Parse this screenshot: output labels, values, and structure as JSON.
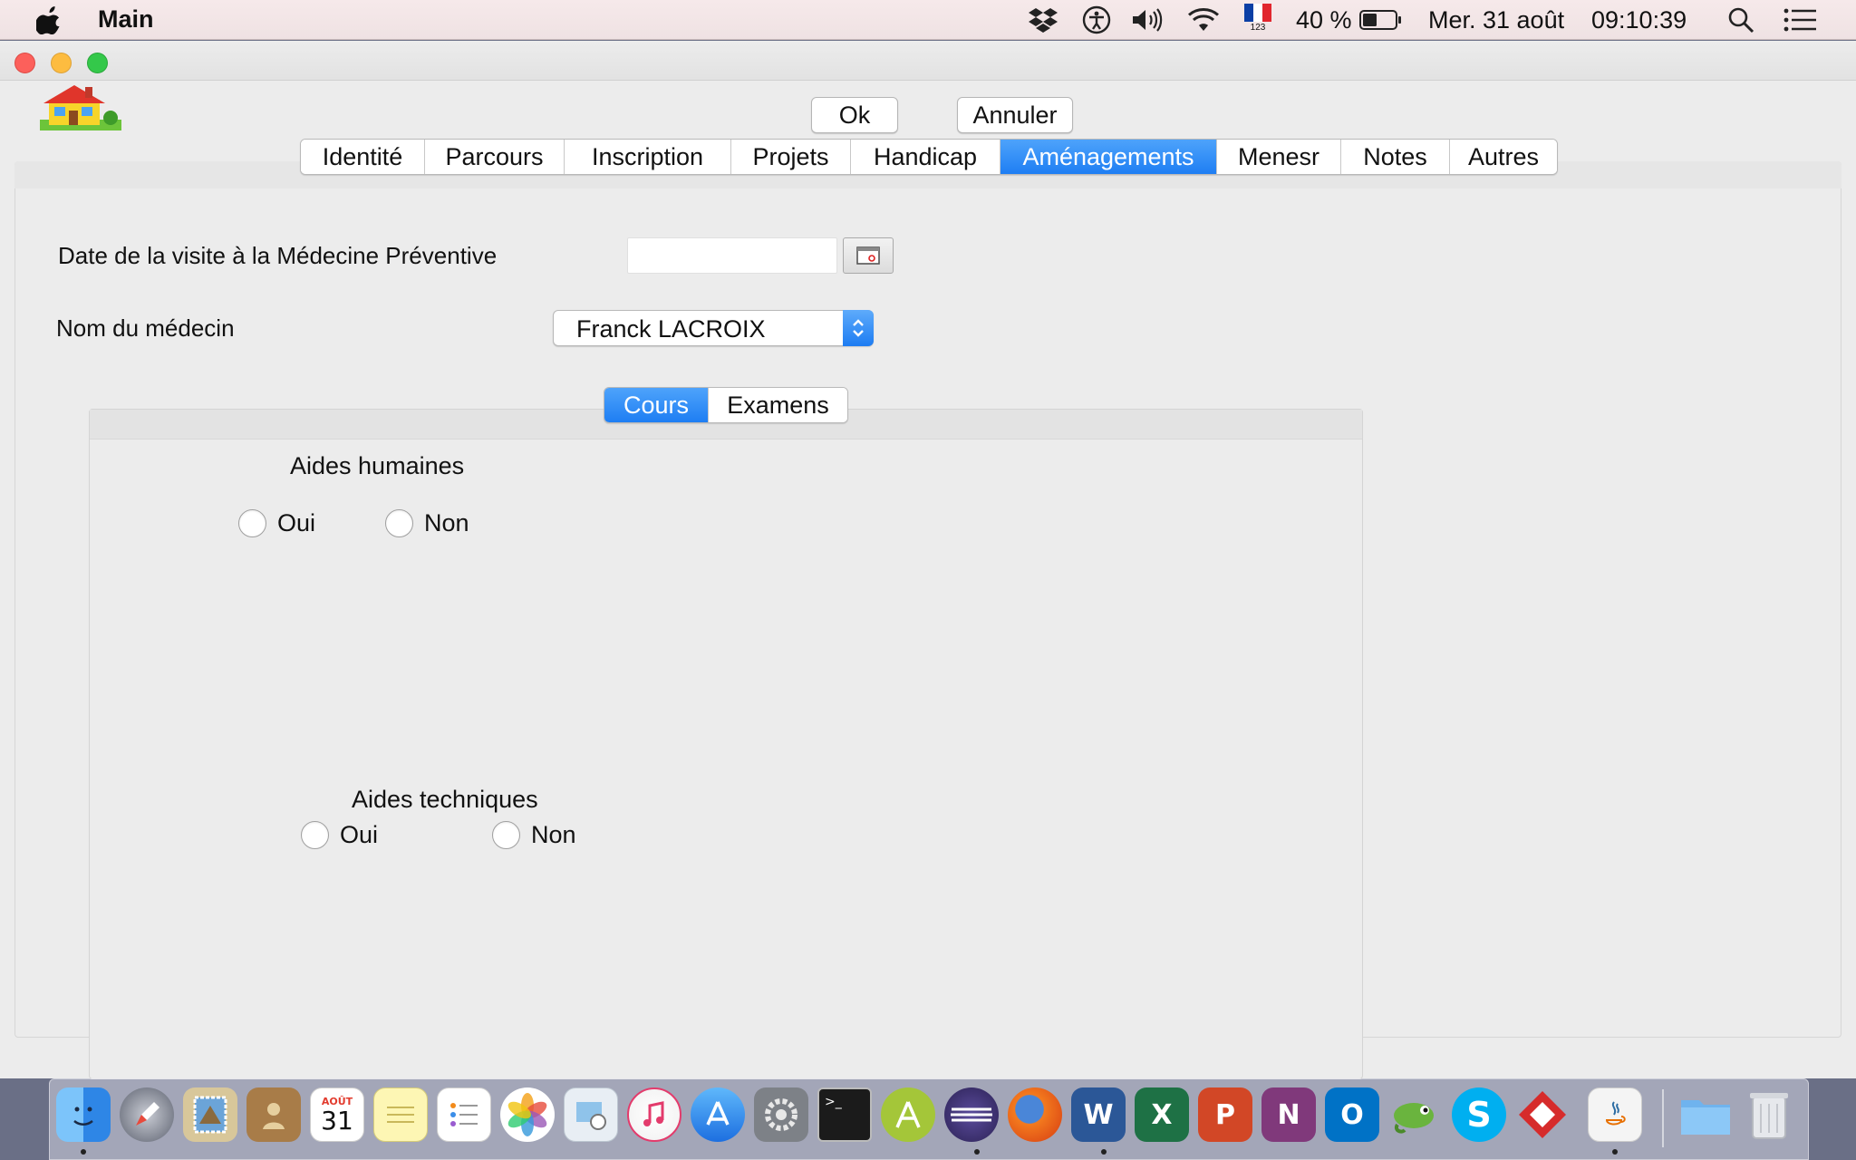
{
  "menubar": {
    "app_name": "Main",
    "battery": "40 %",
    "date": "Mer. 31 août",
    "time": "09:10:39",
    "keyboard_layout": "123",
    "icons": [
      "apple-icon",
      "dropbox-icon",
      "accessibility-icon",
      "volume-icon",
      "wifi-icon",
      "flag-fr-icon",
      "battery-icon",
      "spotlight-icon",
      "notification-center-icon"
    ]
  },
  "window": {
    "buttons": {
      "ok": "Ok",
      "cancel": "Annuler"
    },
    "tabs": [
      {
        "label": "Identité",
        "active": false
      },
      {
        "label": "Parcours",
        "active": false
      },
      {
        "label": "Inscription",
        "active": false
      },
      {
        "label": "Projets",
        "active": false
      },
      {
        "label": "Handicap",
        "active": false
      },
      {
        "label": "Aménagements",
        "active": true
      },
      {
        "label": "Menesr",
        "active": false
      },
      {
        "label": "Notes",
        "active": false
      },
      {
        "label": "Autres",
        "active": false
      }
    ],
    "form": {
      "date_label": "Date de la visite à la Médecine Préventive",
      "date_value": "",
      "doctor_label": "Nom du médecin",
      "doctor_value": "Franck LACROIX"
    },
    "inner_tabs": [
      {
        "label": "Cours",
        "active": true
      },
      {
        "label": "Examens",
        "active": false
      }
    ],
    "aides_humaines": {
      "title": "Aides humaines",
      "yes": "Oui",
      "no": "Non",
      "selected": null
    },
    "aides_techniques": {
      "title": "Aides techniques",
      "yes": "Oui",
      "no": "Non",
      "selected": null
    }
  },
  "dock": {
    "apps": [
      "finder",
      "launchpad",
      "mail-stamp",
      "contacts",
      "calendar",
      "notes",
      "reminders",
      "photos",
      "preview",
      "itunes",
      "app-store",
      "system-preferences",
      "terminal",
      "android-studio",
      "eclipse",
      "firefox",
      "word",
      "excel",
      "powerpoint",
      "onenote",
      "outlook",
      "chameleon",
      "skype",
      "rubymine",
      "java",
      "downloads-folder",
      "trash"
    ],
    "calendar_month": "AOÛT",
    "calendar_day": "31",
    "colors": {
      "finder": "#4aa3f2",
      "word": "#2b5797",
      "excel": "#1e7145",
      "powerpoint": "#d24726",
      "onenote": "#80397b",
      "outlook": "#0072c6",
      "skype": "#00aff0"
    }
  }
}
